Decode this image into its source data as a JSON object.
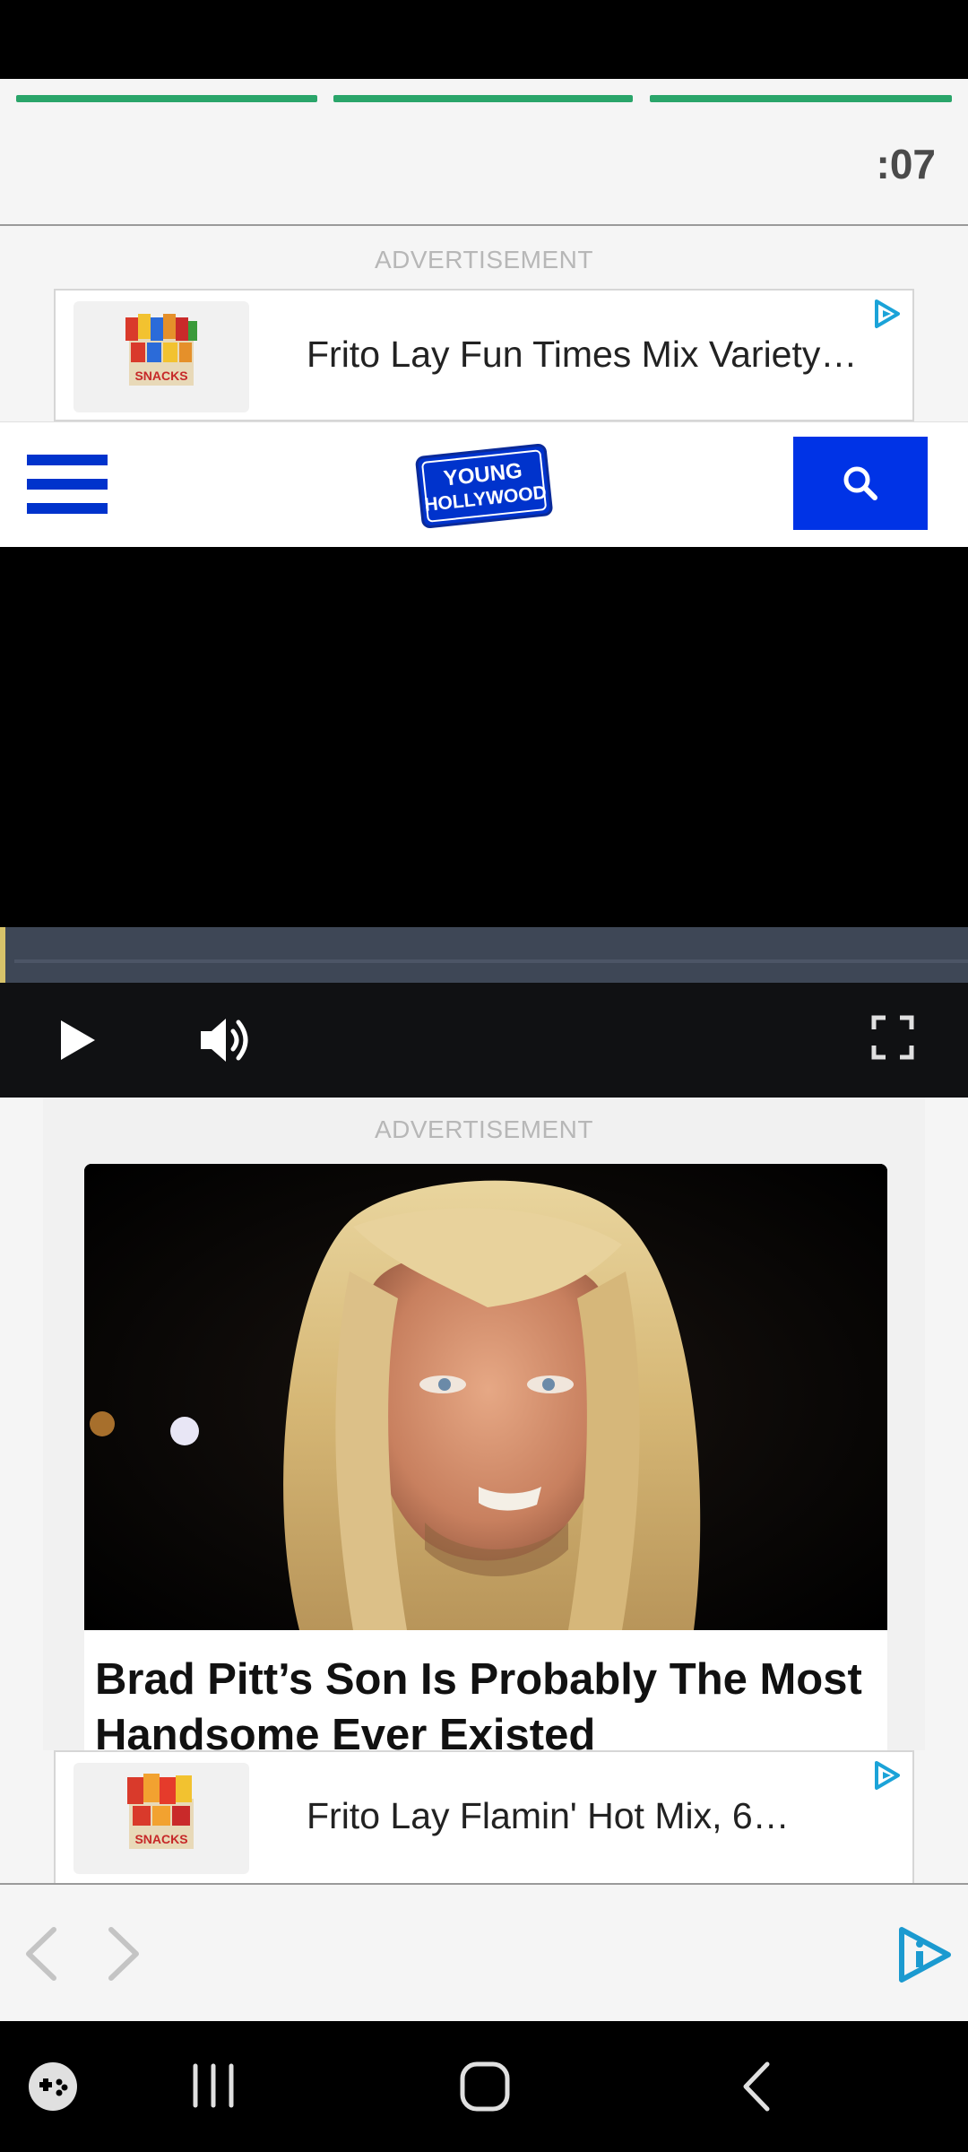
{
  "story": {
    "timer": ":07",
    "progress_segments": 3,
    "accent_color": "#2aa56a"
  },
  "top_ad": {
    "label": "ADVERTISEMENT",
    "product_text": "Frito Lay Fun Times Mix Variety…",
    "thumb": "snack-box-variety-image",
    "choice_icon": "adchoices-icon"
  },
  "site": {
    "menu_icon": "hamburger-menu-icon",
    "logo_line1": "YOUNG",
    "logo_line2": "HOLLYWOOD",
    "search_icon": "search-icon",
    "brand_color": "#0033e6"
  },
  "player": {
    "play_icon": "play-icon",
    "volume_icon": "volume-icon",
    "fullscreen_icon": "fullscreen-icon",
    "progress": 0
  },
  "middle_ad": {
    "label": "ADVERTISEMENT",
    "image": "long-blond-hair-man-portrait",
    "headline": "Brad Pitt’s Son Is Probably The Most Handsome Ever Existed"
  },
  "bottom_ad": {
    "product_text": "Frito Lay Flamin' Hot Mix, 6…",
    "thumb": "snack-box-flamin-hot-image",
    "choice_icon": "adchoices-icon"
  },
  "browser": {
    "back_icon": "chevron-left-icon",
    "forward_icon": "chevron-right-icon",
    "ad_icon": "play-info-icon"
  },
  "system_nav": {
    "game_icon": "game-launcher-icon",
    "recents_icon": "recents-icon",
    "home_icon": "home-icon",
    "back_icon": "back-icon"
  }
}
